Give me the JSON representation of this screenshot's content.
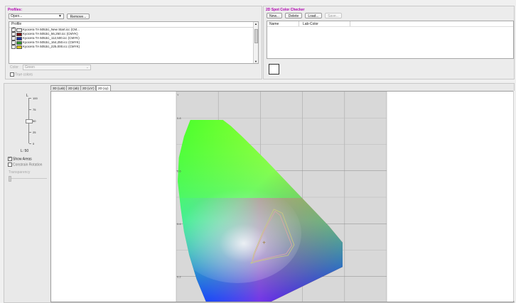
{
  "profiles": {
    "title": "Profiles:",
    "open_select": "Open...",
    "remove_label": "Remove...",
    "column_header": "Profile",
    "items": [
      {
        "label": "Kyocera TA 5053ci_New Start.icc (CM...",
        "checked": true,
        "color": "#ffffff"
      },
      {
        "label": "Kyocera TA 5053ci_56,250.icc (CMYK)",
        "checked": true,
        "color": "#7a1010"
      },
      {
        "label": "Kyocera TA 5053ci_112,500.icc (CMYK)",
        "checked": true,
        "color": "#1a2f9a"
      },
      {
        "label": "Kyocera TA 5053ci_164,250.icc (CMYK)",
        "checked": true,
        "color": "#2e9a2e"
      },
      {
        "label": "Kyocera TA 5053ci_225,000.icc (CMYK)",
        "checked": true,
        "color": "#d9c419"
      }
    ],
    "color_label": "Color",
    "color_value": "Green",
    "true_colors_label": "True colors"
  },
  "spot_checker": {
    "title": "2D Spot Color Checker",
    "buttons": {
      "new": "New...",
      "delete": "Delete",
      "load": "Load...",
      "save": "Save..."
    },
    "columns": {
      "name": "Name",
      "lab": "Lab-Color"
    }
  },
  "tabs": [
    "3D (Lab)",
    "2D (ab)",
    "2D (u'v')",
    "2D (xy)"
  ],
  "lightness": {
    "title": "L",
    "ticks": [
      "100",
      "75",
      "50",
      "25",
      "0"
    ],
    "value_label": "L: 50",
    "value": 50,
    "show_areas_label": "Show Areas",
    "constrain_rotation_label": "Constrain Rotation",
    "transparency_label": "Transparency"
  },
  "chart": {
    "y_ticks": [
      "0.8",
      "0.6",
      "0.4",
      "0.2"
    ],
    "y_axis_top_label": "Y"
  },
  "chart_data": {
    "type": "scatter",
    "title": "",
    "xlabel": "",
    "ylabel": "Y",
    "ylim": [
      0.1,
      0.9
    ],
    "xlim": [
      0.0,
      0.75
    ],
    "y_ticks": [
      0.8,
      0.6,
      0.4,
      0.2
    ],
    "grid": true,
    "series": [
      {
        "name": "",
        "color": "#c8c882",
        "x": [
          0.27,
          0.276,
          0.305,
          0.348,
          0.378,
          0.42,
          0.398,
          0.345,
          0.3,
          0.28,
          0.265
        ],
        "y": [
          0.255,
          0.285,
          0.36,
          0.455,
          0.44,
          0.32,
          0.28,
          0.27,
          0.26,
          0.255,
          0.25
        ]
      },
      {
        "name": "",
        "color": "#d8a8a8",
        "x": [
          0.272,
          0.282,
          0.312,
          0.352,
          0.37,
          0.412,
          0.392,
          0.34,
          0.302,
          0.278
        ],
        "y": [
          0.258,
          0.292,
          0.368,
          0.447,
          0.432,
          0.318,
          0.286,
          0.274,
          0.264,
          0.258
        ]
      }
    ],
    "white_point": {
      "x": 0.313,
      "y": 0.329
    }
  }
}
